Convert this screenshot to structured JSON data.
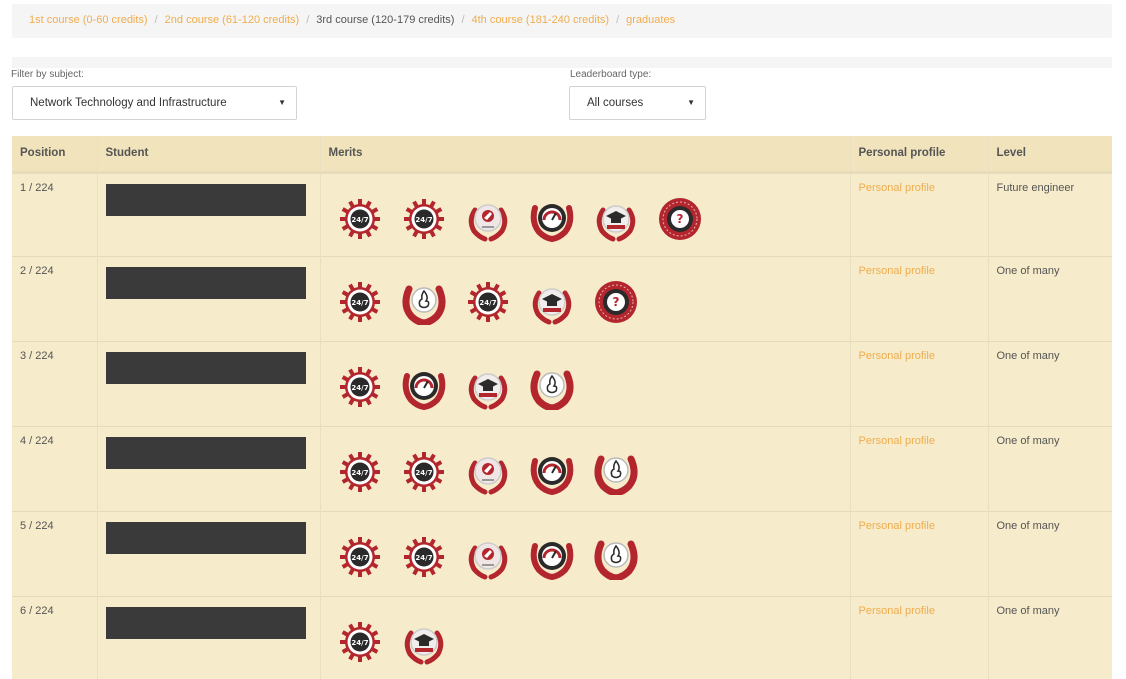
{
  "breadcrumb": {
    "items": [
      {
        "label": "1st course (0-60 credits)",
        "active": false
      },
      {
        "label": "2nd course (61-120 credits)",
        "active": false
      },
      {
        "label": "3rd course (120-179 credits)",
        "active": true
      },
      {
        "label": "4th course (181-240 credits)",
        "active": false
      },
      {
        "label": "graduates",
        "active": false
      }
    ],
    "separator": "/"
  },
  "filters": {
    "subject_label": "Filter by subject:",
    "subject_value": "Network Technology and Infrastructure",
    "leaderboard_label": "Leaderboard type:",
    "leaderboard_value": "All courses",
    "caret": "▼"
  },
  "table": {
    "headers": {
      "position": "Position",
      "student": "Student",
      "merits": "Merits",
      "profile": "Personal profile",
      "level": "Level"
    },
    "rows": [
      {
        "position": "1 / 224",
        "merits": [
          "badge-247-icon",
          "badge-247-icon",
          "badge-horse-icon",
          "badge-gauge-icon",
          "badge-grad-cap-icon",
          "badge-question-icon"
        ],
        "profile": "Personal profile",
        "level": "Future engineer"
      },
      {
        "position": "2 / 224",
        "merits": [
          "badge-247-icon",
          "badge-flame-wreath-icon",
          "badge-247-icon",
          "badge-grad-cap-icon",
          "badge-question-icon"
        ],
        "profile": "Personal profile",
        "level": "One of many"
      },
      {
        "position": "3 / 224",
        "merits": [
          "badge-247-icon",
          "badge-gauge-icon",
          "badge-grad-cap-icon",
          "badge-flame-wreath-icon"
        ],
        "profile": "Personal profile",
        "level": "One of many"
      },
      {
        "position": "4 / 224",
        "merits": [
          "badge-247-icon",
          "badge-247-icon",
          "badge-horse-icon",
          "badge-gauge-icon",
          "badge-flame-wreath-icon"
        ],
        "profile": "Personal profile",
        "level": "One of many"
      },
      {
        "position": "5 / 224",
        "merits": [
          "badge-247-icon",
          "badge-247-icon",
          "badge-horse-icon",
          "badge-gauge-icon",
          "badge-flame-wreath-icon"
        ],
        "profile": "Personal profile",
        "level": "One of many"
      },
      {
        "position": "6 / 224",
        "merits": [
          "badge-247-icon",
          "badge-grad-cap-icon"
        ],
        "profile": "Personal profile",
        "level": "One of many"
      }
    ]
  },
  "colors": {
    "link": "#f0ad4e",
    "table_bg": "#f6ebca",
    "header_bg": "#f1e3bb",
    "badge_red": "#b3262e",
    "badge_dark": "#2a2a2a",
    "redaction": "#3a3a3a"
  }
}
